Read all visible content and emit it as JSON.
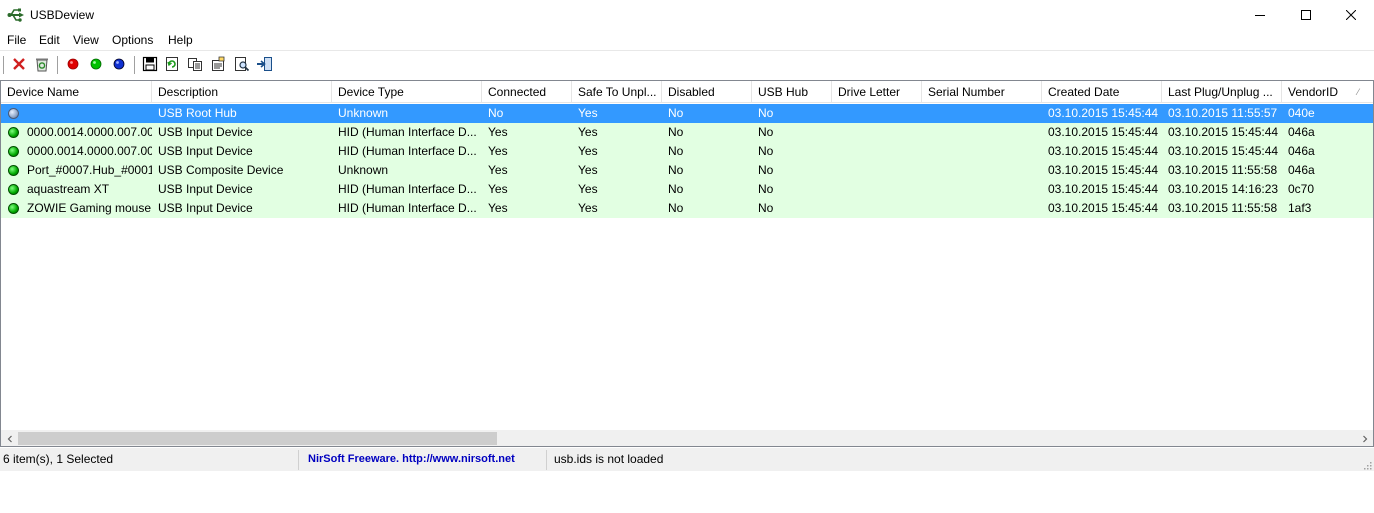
{
  "window": {
    "title": "USBDeview"
  },
  "menu": [
    "File",
    "Edit",
    "View",
    "Options",
    "Help"
  ],
  "toolbar_icons": [
    "disconnect-icon",
    "uninstall-icon",
    "disable-icon",
    "enable-icon",
    "usb-blue-icon",
    "save-icon",
    "refresh-icon",
    "copy-icon",
    "properties-icon",
    "find-icon",
    "exit-icon"
  ],
  "columns": [
    "Device Name",
    "Description",
    "Device Type",
    "Connected",
    "Safe To Unpl...",
    "Disabled",
    "USB Hub",
    "Drive Letter",
    "Serial Number",
    "Created Date",
    "Last Plug/Unplug ...",
    "VendorID"
  ],
  "rows": [
    {
      "status": "grey",
      "selected": true,
      "cells": [
        "",
        "USB Root Hub",
        "Unknown",
        "No",
        "Yes",
        "No",
        "No",
        "",
        "",
        "03.10.2015 15:45:44",
        "03.10.2015 11:55:57",
        "040e"
      ]
    },
    {
      "status": "green",
      "selected": false,
      "cells": [
        "0000.0014.0000.007.00...",
        "USB Input Device",
        "HID (Human Interface D...",
        "Yes",
        "Yes",
        "No",
        "No",
        "",
        "",
        "03.10.2015 15:45:44",
        "03.10.2015 15:45:44",
        "046a"
      ]
    },
    {
      "status": "green",
      "selected": false,
      "cells": [
        "0000.0014.0000.007.00...",
        "USB Input Device",
        "HID (Human Interface D...",
        "Yes",
        "Yes",
        "No",
        "No",
        "",
        "",
        "03.10.2015 15:45:44",
        "03.10.2015 15:45:44",
        "046a"
      ]
    },
    {
      "status": "green",
      "selected": false,
      "cells": [
        "Port_#0007.Hub_#0001",
        "USB Composite Device",
        "Unknown",
        "Yes",
        "Yes",
        "No",
        "No",
        "",
        "",
        "03.10.2015 15:45:44",
        "03.10.2015 11:55:58",
        "046a"
      ]
    },
    {
      "status": "green",
      "selected": false,
      "cells": [
        "aquastream XT",
        "USB Input Device",
        "HID (Human Interface D...",
        "Yes",
        "Yes",
        "No",
        "No",
        "",
        "",
        "03.10.2015 15:45:44",
        "03.10.2015 14:16:23",
        "0c70"
      ]
    },
    {
      "status": "green",
      "selected": false,
      "cells": [
        "ZOWIE Gaming mouse",
        "USB Input Device",
        "HID (Human Interface D...",
        "Yes",
        "Yes",
        "No",
        "No",
        "",
        "",
        "03.10.2015 15:45:44",
        "03.10.2015 11:55:58",
        "1af3"
      ]
    }
  ],
  "status": {
    "count": "6 item(s), 1 Selected",
    "link": "NirSoft Freeware.  http://www.nirsoft.net",
    "usbids": "usb.ids is not loaded"
  },
  "colors": {
    "row_bg": "#e2ffe2",
    "selection": "#3399ff",
    "link": "#0000c0"
  }
}
